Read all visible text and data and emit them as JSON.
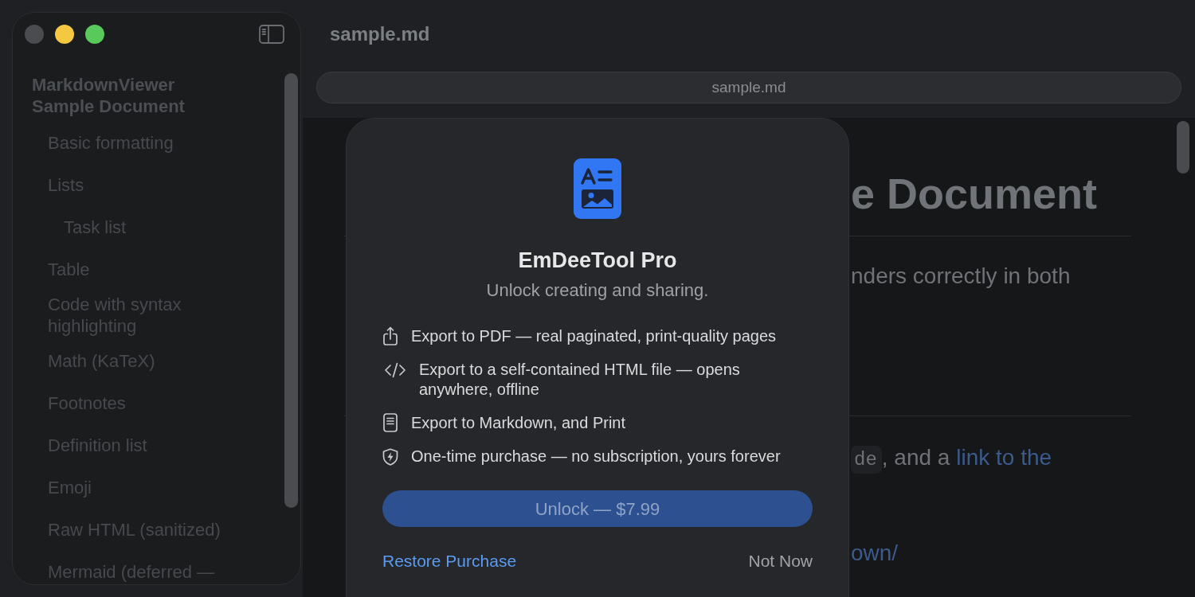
{
  "window": {
    "controls": [
      {
        "kind": "close",
        "disabled": true
      },
      {
        "kind": "minimize",
        "disabled": false
      },
      {
        "kind": "zoom",
        "disabled": false
      }
    ]
  },
  "sidebar": {
    "title": "MarkdownViewer Sample Document",
    "items": [
      {
        "label": "Basic formatting"
      },
      {
        "label": "Lists",
        "children": [
          {
            "label": "Task list"
          }
        ]
      },
      {
        "label": "Table"
      },
      {
        "label": "Code with syntax highlighting"
      },
      {
        "label": "Math (KaTeX)"
      },
      {
        "label": "Footnotes"
      },
      {
        "label": "Definition list"
      },
      {
        "label": "Emoji"
      },
      {
        "label": "Raw HTML (sanitized)"
      },
      {
        "label": "Mermaid (deferred —"
      }
    ]
  },
  "toolbar": {
    "title": "sample.md",
    "path": "sample.md"
  },
  "document": {
    "heading": "e Document",
    "lines": [
      [
        {
          "kind": "text",
          "text": "nders correctly in both"
        }
      ],
      [
        {
          "kind": "code",
          "text": "de"
        },
        {
          "kind": "text",
          "text": ", and a "
        },
        {
          "kind": "link",
          "text": "link to the"
        }
      ],
      [
        {
          "kind": "link",
          "text": "own/"
        }
      ]
    ]
  },
  "dialog": {
    "title": "EmDeeTool Pro",
    "subtitle": "Unlock creating and sharing.",
    "features": [
      {
        "kind": "share",
        "text": "Export to PDF — real paginated, print-quality pages"
      },
      {
        "kind": "code",
        "text": "Export to a self-contained HTML file — opens anywhere, offline"
      },
      {
        "kind": "document",
        "text": "Export to Markdown, and Print"
      },
      {
        "kind": "shield",
        "text": "One-time purchase — no subscription, yours forever"
      }
    ],
    "primary_button": {
      "label": "Unlock — $7.99",
      "disabled": true
    },
    "restore_link": "Restore Purchase",
    "dismiss_button": "Not Now"
  }
}
